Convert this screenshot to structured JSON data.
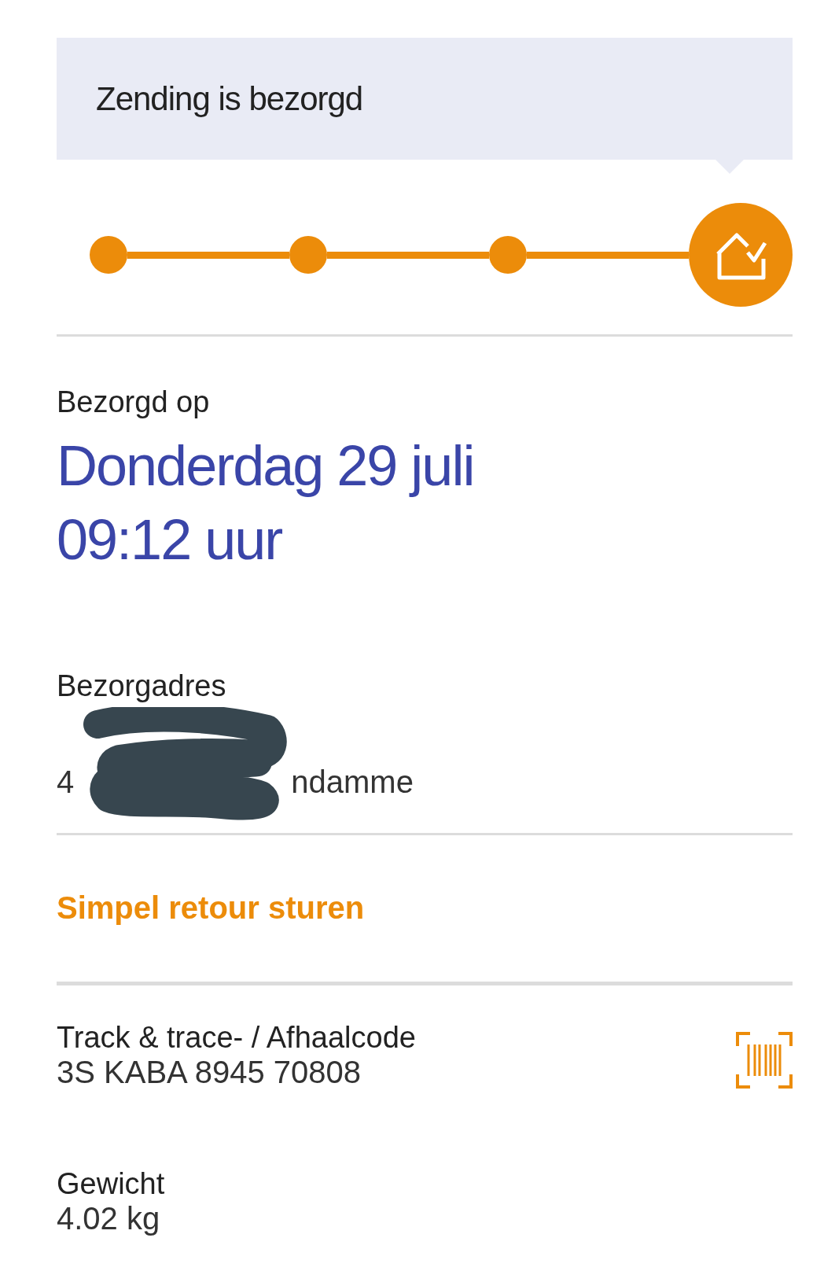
{
  "status_banner": {
    "title": "Zending is bezorgd"
  },
  "progress": {
    "steps": [
      {
        "completed": true,
        "current": false
      },
      {
        "completed": true,
        "current": false
      },
      {
        "completed": true,
        "current": false
      },
      {
        "completed": true,
        "current": true
      }
    ]
  },
  "delivered": {
    "label": "Bezorgd op",
    "date": "Donderdag 29 juli",
    "time": "09:12 uur"
  },
  "address": {
    "label": "Bezorgadres",
    "line_2_start": "4",
    "line_2_end": "ndamme"
  },
  "return_link": "Simpel retour sturen",
  "tracking": {
    "label": "Track & trace- / Afhaalcode",
    "code": "3S KABA 8945 70808"
  },
  "weight": {
    "label": "Gewicht",
    "value": "4.02 kg"
  }
}
